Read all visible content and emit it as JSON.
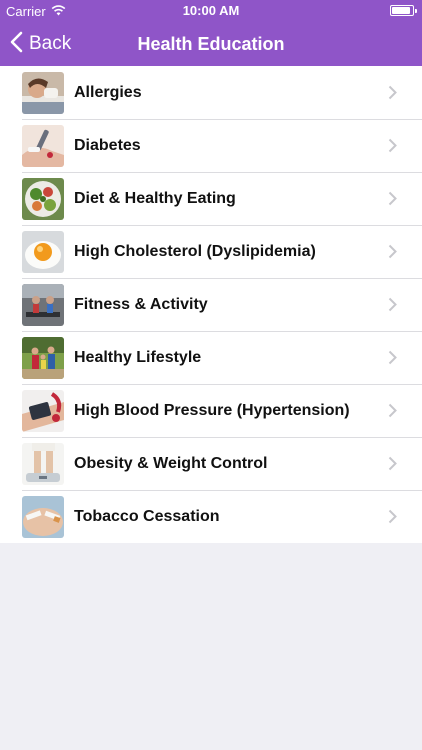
{
  "status_bar": {
    "carrier": "Carrier",
    "time": "10:00 AM",
    "battery_level": 0.9
  },
  "nav": {
    "back_label": "Back",
    "title": "Health Education"
  },
  "colors": {
    "accent": "#8f55c8",
    "background": "#efeff4"
  },
  "topics": [
    {
      "label": "Allergies",
      "thumbnail": "person-sneezing-photo"
    },
    {
      "label": "Diabetes",
      "thumbnail": "glucose-test-photo"
    },
    {
      "label": "Diet & Healthy Eating",
      "thumbnail": "salad-photo"
    },
    {
      "label": "High Cholesterol (Dyslipidemia)",
      "thumbnail": "fried-egg-photo"
    },
    {
      "label": "Fitness & Activity",
      "thumbnail": "treadmill-photo"
    },
    {
      "label": "Healthy Lifestyle",
      "thumbnail": "family-outdoors-photo"
    },
    {
      "label": "High Blood Pressure (Hypertension)",
      "thumbnail": "blood-pressure-cuff-photo"
    },
    {
      "label": "Obesity & Weight Control",
      "thumbnail": "legs-on-scale-photo"
    },
    {
      "label": "Tobacco Cessation",
      "thumbnail": "broken-cigarette-photo"
    }
  ]
}
